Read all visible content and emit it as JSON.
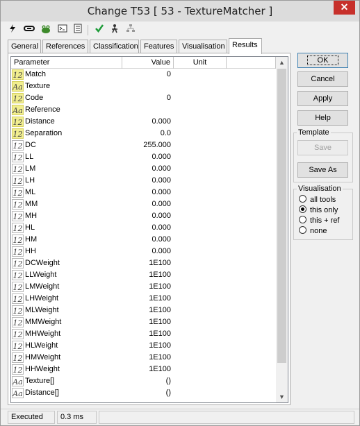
{
  "window": {
    "title": "Change T53 [ 53 - TextureMatcher ]",
    "close_glyph": "✕"
  },
  "toolbar": {
    "icons": [
      "lightning-icon",
      "link-icon",
      "frog-icon",
      "console-icon",
      "document-icon",
      "checkmark-icon",
      "run-icon",
      "tree-icon"
    ]
  },
  "tabs": [
    "General",
    "References",
    "Classification",
    "Features",
    "Visualisation",
    "Results"
  ],
  "active_tab": "Results",
  "grid": {
    "columns": [
      "Parameter",
      "Value",
      "Unit"
    ],
    "rows": [
      {
        "type": "num",
        "hl": true,
        "name": "Match",
        "value": "0"
      },
      {
        "type": "txt",
        "hl": true,
        "name": "Texture",
        "value": ""
      },
      {
        "type": "num",
        "hl": true,
        "name": "Code",
        "value": "0"
      },
      {
        "type": "txt",
        "hl": true,
        "name": "Reference",
        "value": ""
      },
      {
        "type": "num",
        "hl": true,
        "name": "Distance",
        "value": "0.000"
      },
      {
        "type": "num",
        "hl": true,
        "name": "Separation",
        "value": "0.0"
      },
      {
        "type": "num",
        "hl": false,
        "name": "DC",
        "value": "255.000"
      },
      {
        "type": "num",
        "hl": false,
        "name": "LL",
        "value": "0.000"
      },
      {
        "type": "num",
        "hl": false,
        "name": "LM",
        "value": "0.000"
      },
      {
        "type": "num",
        "hl": false,
        "name": "LH",
        "value": "0.000"
      },
      {
        "type": "num",
        "hl": false,
        "name": "ML",
        "value": "0.000"
      },
      {
        "type": "num",
        "hl": false,
        "name": "MM",
        "value": "0.000"
      },
      {
        "type": "num",
        "hl": false,
        "name": "MH",
        "value": "0.000"
      },
      {
        "type": "num",
        "hl": false,
        "name": "HL",
        "value": "0.000"
      },
      {
        "type": "num",
        "hl": false,
        "name": "HM",
        "value": "0.000"
      },
      {
        "type": "num",
        "hl": false,
        "name": "HH",
        "value": "0.000"
      },
      {
        "type": "num",
        "hl": false,
        "name": "DCWeight",
        "value": "1E100"
      },
      {
        "type": "num",
        "hl": false,
        "name": "LLWeight",
        "value": "1E100"
      },
      {
        "type": "num",
        "hl": false,
        "name": "LMWeight",
        "value": "1E100"
      },
      {
        "type": "num",
        "hl": false,
        "name": "LHWeight",
        "value": "1E100"
      },
      {
        "type": "num",
        "hl": false,
        "name": "MLWeight",
        "value": "1E100"
      },
      {
        "type": "num",
        "hl": false,
        "name": "MMWeight",
        "value": "1E100"
      },
      {
        "type": "num",
        "hl": false,
        "name": "MHWeight",
        "value": "1E100"
      },
      {
        "type": "num",
        "hl": false,
        "name": "HLWeight",
        "value": "1E100"
      },
      {
        "type": "num",
        "hl": false,
        "name": "HMWeight",
        "value": "1E100"
      },
      {
        "type": "num",
        "hl": false,
        "name": "HHWeight",
        "value": "1E100"
      },
      {
        "type": "txt",
        "hl": false,
        "name": "Texture[]",
        "value": "()"
      },
      {
        "type": "txt",
        "hl": false,
        "name": "Distance[]",
        "value": "()"
      }
    ]
  },
  "buttons": {
    "ok": "OK",
    "cancel": "Cancel",
    "apply": "Apply",
    "help": "Help"
  },
  "template": {
    "legend": "Template",
    "save": "Save",
    "save_as": "Save As"
  },
  "visualisation": {
    "legend": "Visualisation",
    "options": [
      "all tools",
      "this only",
      "this + ref",
      "none"
    ],
    "selected": "this only"
  },
  "status": {
    "state": "Executed",
    "time": "0.3 ms"
  },
  "icon_glyphs": {
    "num": "12",
    "txt": "Aa"
  },
  "colors": {
    "highlight": "#f1ee8f",
    "close": "#c7302b"
  }
}
